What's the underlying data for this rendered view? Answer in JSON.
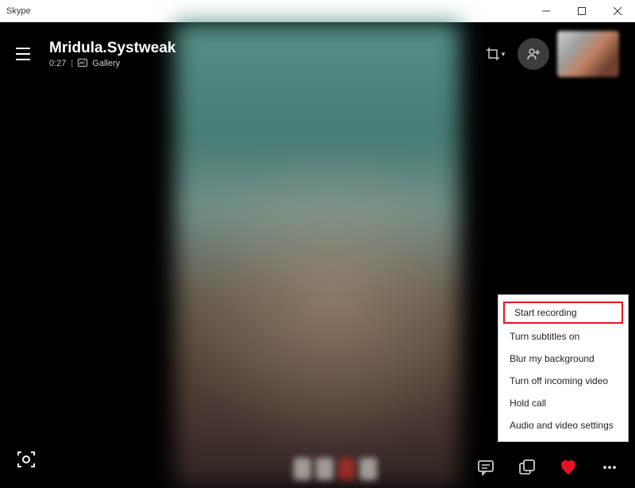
{
  "window": {
    "title": "Skype"
  },
  "call": {
    "contact": "Mridula.Systweak",
    "duration": "0:27",
    "panel_label": "Gallery"
  },
  "menu": {
    "start_recording": "Start recording",
    "subtitles": "Turn subtitles on",
    "blur": "Blur my background",
    "incoming": "Turn off incoming video",
    "hold": "Hold call",
    "av_settings": "Audio and video settings"
  }
}
